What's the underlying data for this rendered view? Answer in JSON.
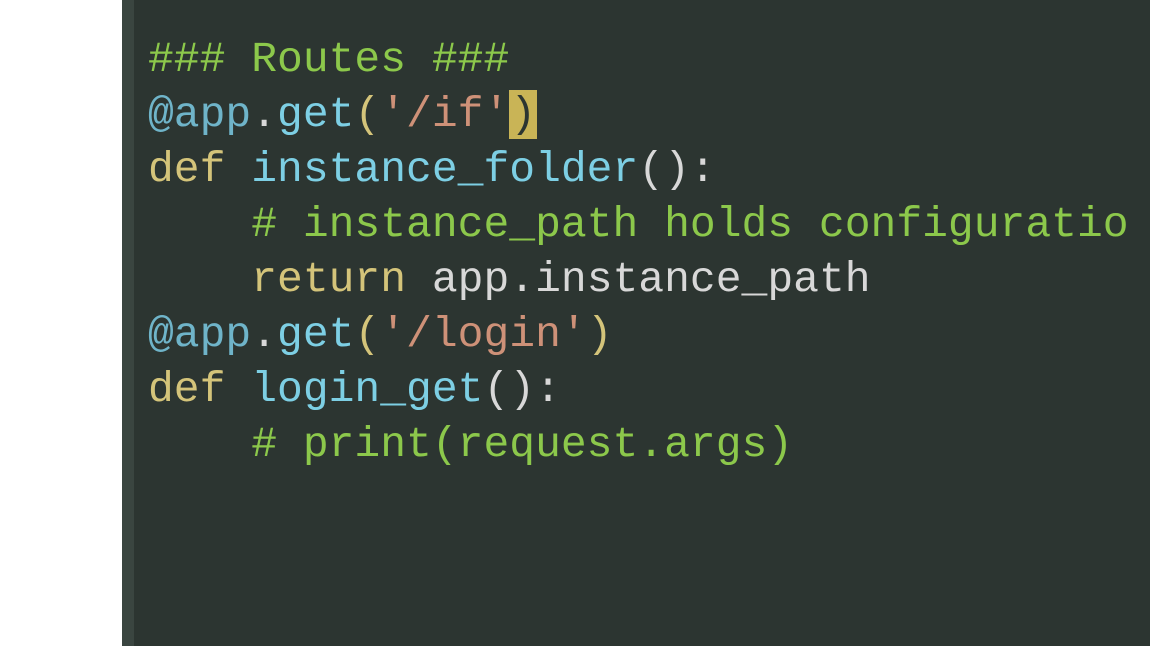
{
  "editor": {
    "lines": {
      "l1_comment": "### Routes ###",
      "l2_blank": "",
      "l3_decorator_at": "@app",
      "l3_dot": ".",
      "l3_method": "get",
      "l3_open": "(",
      "l3_string": "'/if'",
      "l3_close": ")",
      "l4_def": "def ",
      "l4_func": "instance_folder",
      "l4_parens": "():",
      "l5_comment": "    # instance_path holds configuratio",
      "l6_return": "    return ",
      "l6_obj": "app",
      "l6_dot": ".",
      "l6_prop": "instance_path",
      "l7_blank": "",
      "l8_blank": "",
      "l9_at": "@app",
      "l9_dot": ".",
      "l9_method": "get",
      "l9_open": "(",
      "l9_string": "'/login'",
      "l9_close": ")",
      "l10_def": "def ",
      "l10_func": "login_get",
      "l10_parens": "():",
      "l11_comment": "    # print(request.args)"
    }
  }
}
